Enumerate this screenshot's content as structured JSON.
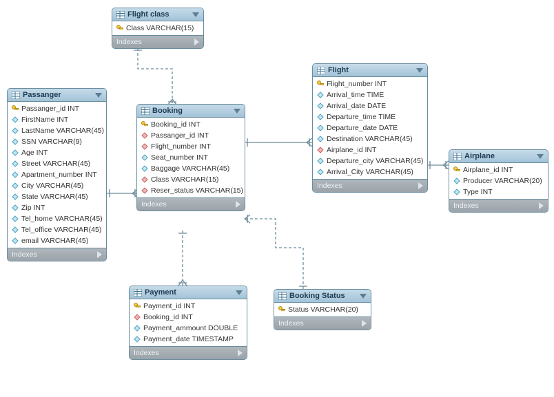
{
  "footer_label": "Indexes",
  "entities": {
    "flight_class": {
      "title": "Flight class",
      "columns": [
        {
          "kind": "pk",
          "text": "Class VARCHAR(15)"
        }
      ]
    },
    "passanger": {
      "title": "Passanger",
      "columns": [
        {
          "kind": "pk",
          "text": "Passanger_id INT"
        },
        {
          "kind": "attr",
          "text": "FirstName INT"
        },
        {
          "kind": "attr",
          "text": "LastName VARCHAR(45)"
        },
        {
          "kind": "attr",
          "text": "SSN VARCHAR(9)"
        },
        {
          "kind": "attr",
          "text": "Age INT"
        },
        {
          "kind": "attr",
          "text": "Street VARCHAR(45)"
        },
        {
          "kind": "attr",
          "text": "Apartment_number INT"
        },
        {
          "kind": "attr",
          "text": "City VARCHAR(45)"
        },
        {
          "kind": "attr",
          "text": "State VARCHAR(45)"
        },
        {
          "kind": "attr",
          "text": "Zip INT"
        },
        {
          "kind": "attr",
          "text": "Tel_home VARCHAR(45)"
        },
        {
          "kind": "attr",
          "text": "Tel_office VARCHAR(45)"
        },
        {
          "kind": "attr",
          "text": "email VARCHAR(45)"
        }
      ]
    },
    "booking": {
      "title": "Booking",
      "columns": [
        {
          "kind": "pk",
          "text": "Booking_id INT"
        },
        {
          "kind": "fk",
          "text": "Passanger_id INT"
        },
        {
          "kind": "fk",
          "text": "Flight_number INT"
        },
        {
          "kind": "attr",
          "text": "Seat_number INT"
        },
        {
          "kind": "attr",
          "text": "Baggage VARCHAR(45)"
        },
        {
          "kind": "fk",
          "text": "Class VARCHAR(15)"
        },
        {
          "kind": "fk",
          "text": "Reser_status VARCHAR(15)"
        }
      ]
    },
    "flight": {
      "title": "Flight",
      "columns": [
        {
          "kind": "pk",
          "text": "Flight_number INT"
        },
        {
          "kind": "attr",
          "text": "Arrival_time TIME"
        },
        {
          "kind": "attr",
          "text": "Arrival_date DATE"
        },
        {
          "kind": "attr",
          "text": "Departure_time TIME"
        },
        {
          "kind": "attr",
          "text": "Departure_date DATE"
        },
        {
          "kind": "attr",
          "text": "Destination VARCHAR(45)"
        },
        {
          "kind": "fk",
          "text": "Airplane_id INT"
        },
        {
          "kind": "attr",
          "text": "Departure_city VARCHAR(45)"
        },
        {
          "kind": "attr",
          "text": "Arrival_City VARCHAR(45)"
        }
      ]
    },
    "airplane": {
      "title": "Airplane",
      "columns": [
        {
          "kind": "pk",
          "text": "Airplane_id INT"
        },
        {
          "kind": "attr",
          "text": "Producer VARCHAR(20)"
        },
        {
          "kind": "attr",
          "text": "Type INT"
        }
      ]
    },
    "payment": {
      "title": "Payment",
      "columns": [
        {
          "kind": "pk",
          "text": "Payment_id INT"
        },
        {
          "kind": "fk",
          "text": "Booking_id INT"
        },
        {
          "kind": "attr",
          "text": "Payment_ammount DOUBLE"
        },
        {
          "kind": "attr",
          "text": "Payment_date TIMESTAMP"
        }
      ]
    },
    "booking_status": {
      "title": "Booking Status",
      "columns": [
        {
          "kind": "pk",
          "text": "Status VARCHAR(20)"
        }
      ]
    }
  },
  "diagram": {
    "type": "er-diagram",
    "relations": [
      {
        "from": "flight_class",
        "to": "booking",
        "style": "dashed"
      },
      {
        "from": "passanger",
        "to": "booking",
        "style": "solid"
      },
      {
        "from": "booking",
        "to": "flight",
        "style": "solid"
      },
      {
        "from": "flight",
        "to": "airplane",
        "style": "solid"
      },
      {
        "from": "booking",
        "to": "payment",
        "style": "dashed"
      },
      {
        "from": "booking_status",
        "to": "booking",
        "style": "dashed"
      }
    ]
  }
}
